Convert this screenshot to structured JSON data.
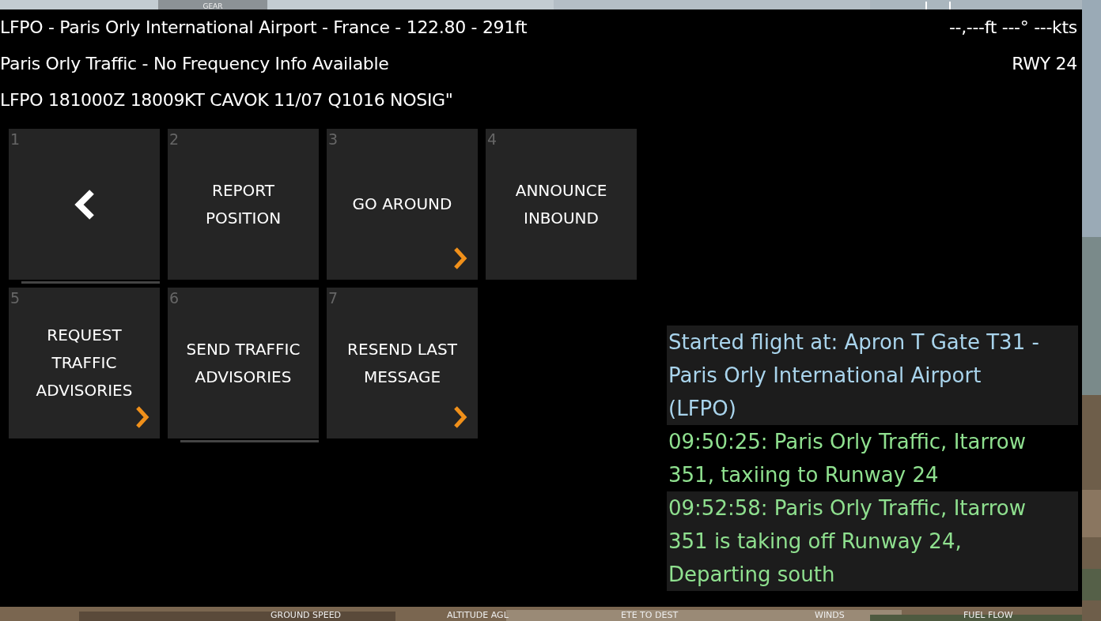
{
  "background_labels": {
    "top": [
      "GEAR"
    ],
    "bottom": [
      "GROUND SPEED",
      "ALTITUDE AGL",
      "ETE TO DEST",
      "WINDS",
      "FUEL FLOW"
    ]
  },
  "header": {
    "airport_line": "LFPO - Paris Orly International Airport - France - 122.80 - 291ft",
    "readout": "--,---ft  ---° ---kts",
    "frequency_line": "Paris Orly Traffic - No Frequency Info Available",
    "runway": "RWY 24",
    "metar": "LFPO 181000Z 18009KT CAVOK 11/07 Q1016 NOSIG\""
  },
  "buttons": [
    {
      "number": "1",
      "kind": "back",
      "submenu": false,
      "underline": true
    },
    {
      "number": "2",
      "kind": "text",
      "label": "REPORT POSITION",
      "submenu": false,
      "underline": false
    },
    {
      "number": "3",
      "kind": "text",
      "label": "GO AROUND",
      "submenu": true,
      "underline": false
    },
    {
      "number": "4",
      "kind": "text",
      "label": "ANNOUNCE INBOUND",
      "submenu": false,
      "underline": false
    },
    {
      "number": "5",
      "kind": "text",
      "label": "REQUEST TRAFFIC ADVISORIES",
      "submenu": true,
      "underline": false
    },
    {
      "number": "6",
      "kind": "text",
      "label": "SEND TRAFFIC ADVISORIES",
      "submenu": false,
      "underline": true
    },
    {
      "number": "7",
      "kind": "text",
      "label": "RESEND LAST MESSAGE",
      "submenu": true,
      "underline": false
    }
  ],
  "messages": [
    {
      "text": "Started flight at: Apron T Gate T31 - Paris Orly International Airport (LFPO)",
      "color": "#a9d4ec"
    },
    {
      "text": "09:50:25: Paris Orly Traffic, Itarrow 351, taxiing to Runway 24",
      "color": "#8fe08f"
    },
    {
      "text": "09:52:58: Paris Orly Traffic, Itarrow 351 is taking off Runway 24, Departing south",
      "color": "#8fe08f"
    }
  ]
}
